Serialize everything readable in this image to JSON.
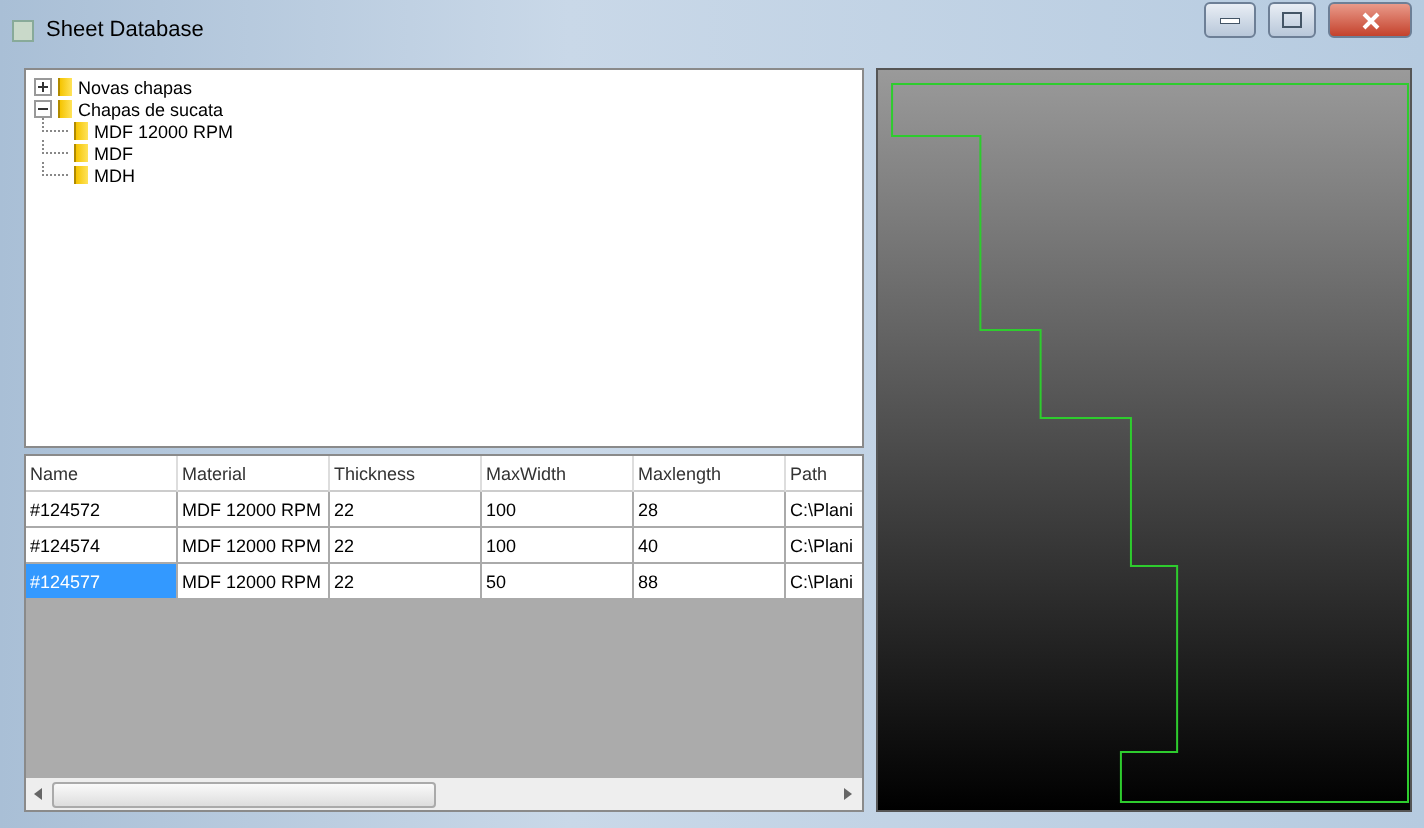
{
  "window": {
    "title": "Sheet Database"
  },
  "tree": [
    {
      "label": "Novas chapas",
      "expanded": false
    },
    {
      "label": "Chapas de sucata",
      "expanded": true,
      "children": [
        {
          "label": "MDF 12000 RPM"
        },
        {
          "label": "MDF"
        },
        {
          "label": "MDH"
        }
      ]
    }
  ],
  "table": {
    "columns": [
      "Name",
      "Material",
      "Thickness",
      "MaxWidth",
      "Maxlength",
      "Path"
    ],
    "rows": [
      {
        "cells": [
          "#124572",
          "MDF 12000 RPM",
          "22",
          "100",
          "28",
          "C:\\Plani"
        ],
        "selected": false
      },
      {
        "cells": [
          "#124574",
          "MDF 12000 RPM",
          "22",
          "100",
          "40",
          "C:\\Plani"
        ],
        "selected": false
      },
      {
        "cells": [
          "#124577",
          "MDF 12000 RPM",
          "22",
          "50",
          "88",
          "C:\\Plani"
        ],
        "selected": true
      }
    ]
  }
}
